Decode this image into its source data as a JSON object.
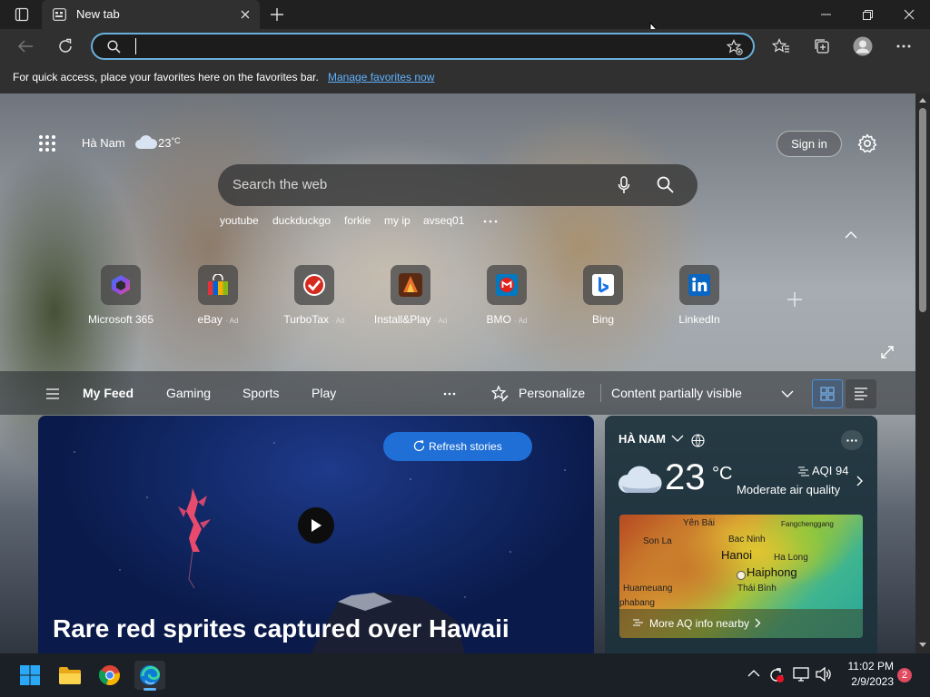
{
  "browser": {
    "tab_title": "New tab",
    "address_value": "",
    "favorites_message": "For quick access, place your favorites here on the favorites bar.",
    "favorites_link": "Manage favorites now"
  },
  "newtab": {
    "location": "Hà Nam",
    "temp": "23",
    "temp_unit": "°C",
    "sign_in": "Sign in",
    "search_placeholder": "Search the web",
    "quick_links": [
      "youtube",
      "duckduckgo",
      "forkie",
      "my ip",
      "avseq01"
    ],
    "tiles": [
      {
        "name": "Microsoft 365",
        "ad": "",
        "icon": "microsoft365-icon"
      },
      {
        "name": "eBay",
        "ad": "· Ad",
        "icon": "ebay-icon"
      },
      {
        "name": "TurboTax",
        "ad": "· Ad",
        "icon": "turbotax-icon"
      },
      {
        "name": "Install&Play",
        "ad": "· Ad",
        "icon": "install-play-icon"
      },
      {
        "name": "BMO",
        "ad": "· Ad",
        "icon": "bmo-icon"
      },
      {
        "name": "Bing",
        "ad": "",
        "icon": "bing-icon"
      },
      {
        "name": "LinkedIn",
        "ad": "",
        "icon": "linkedin-icon"
      }
    ],
    "feed_nav": [
      "My Feed",
      "Gaming",
      "Sports",
      "Play"
    ],
    "personalize": "Personalize",
    "content_visibility": "Content partially visible",
    "refresh_stories": "Refresh stories",
    "hero_title": "Rare red sprites captured over Hawaii"
  },
  "weather": {
    "location": "HÀ NAM",
    "temp": "23",
    "unit": "°C",
    "aqi_label": "AQI 94",
    "aqi_desc": "Moderate air quality",
    "map_cities": [
      "Yên Bái",
      "Fangchenggang",
      "Bac Ninh",
      "Son La",
      "Hanoi",
      "Ha Long",
      "Haiphong",
      "Huameuang",
      "Thái Bình",
      "phabang"
    ],
    "more_aq": "More AQ info nearby"
  },
  "taskbar": {
    "time": "11:02 PM",
    "date": "2/9/2023",
    "notification_count": "2"
  }
}
